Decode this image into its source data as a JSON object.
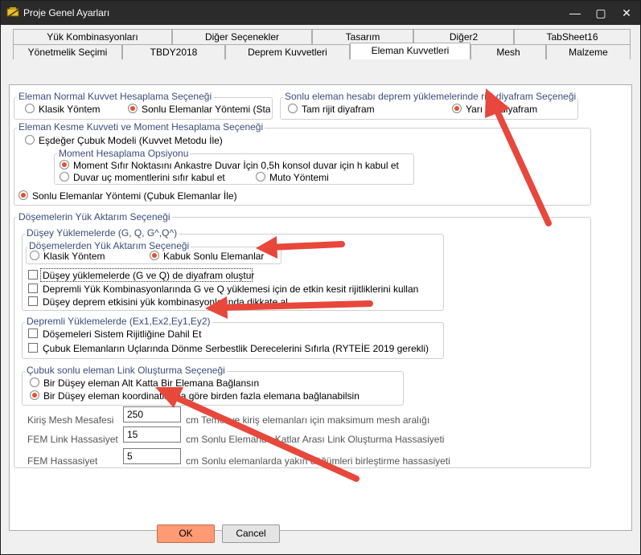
{
  "window": {
    "title": "Proje Genel Ayarları"
  },
  "tabs_row1": [
    "Yük Kombinasyonları",
    "Diğer Seçenekler",
    "Tasarım",
    "Diğer2",
    "TabSheet16"
  ],
  "tabs_row2": [
    "Yönetmelik Seçimi",
    "TBDY2018",
    "Deprem Kuvvetleri",
    "Eleman Kuvvetleri",
    "Mesh",
    "Malzeme"
  ],
  "active_tab": "Eleman Kuvvetleri",
  "normal_force": {
    "title": "Eleman Normal Kuvvet Hesaplama Seçeneği",
    "opt1": "Klasik Yöntem",
    "opt2": "Sonlu Elemanlar Yöntemi (Stat"
  },
  "diaphragm": {
    "title": "Sonlu eleman hesabı deprem yüklemelerinde rijit diyafram Seçeneği",
    "opt1": "Tam rijit diyafram",
    "opt2": "Yarı rijit diyafram"
  },
  "shear_moment": {
    "title": "Eleman Kesme Kuvveti ve Moment Hesaplama Seçeneği",
    "opt1": "Eşdeğer Çubuk Modeli (Kuvvet Metodu İle)",
    "moment_title": "Moment Hesaplama Opsiyonu",
    "m_opt1": "Moment Sıfır Noktasını Ankastre Duvar İçin 0,5h konsol duvar için h kabul et",
    "m_opt2": "Duvar uç momentlerini sıfır kabul et",
    "m_opt3": "Muto Yöntemi",
    "opt2": "Sonlu Elemanlar Yöntemi (Çubuk Elemanlar İle)"
  },
  "slab": {
    "title": "Döşemelerin Yük Aktarım Seçeneği",
    "vertical_title": "Düşey Yüklemelerde (G, Q, G^,Q^)",
    "transfer_title": "Döşemelerden  Yük Aktarım Seçeneği",
    "t_opt1": "Klasik Yöntem",
    "t_opt2": "Kabuk Sonlu Elemanlar",
    "chk1": "Düşey yüklemelerde (G ve Q) de diyafram oluştur",
    "chk2": "Depremli Yük Kombinasyonlarında G ve Q yüklemesi için de etkin kesit rijitliklerini kullan",
    "chk3": "Düşey deprem etkisini yük kombinasyonlarında dikkate al",
    "seismic_title": "Depremli Yüklemelerde (Ex1,Ex2,Ey1,Ey2)",
    "chk4": "Döşemeleri Sistem Rijitliğine Dahil Et",
    "chk5": "Çubuk Elemanların Uçlarında  Dönme Serbestlik Derecelerini Sıfırla (RYTEİE 2019 gerekli)",
    "link_title": "Çubuk sonlu eleman Link Oluşturma Seçeneği",
    "l_opt1": "Bir Düşey eleman Alt Katta Bir Elemana Bağlansın",
    "l_opt2": "Bir Düşey eleman koordinatlarına göre birden fazla elemana bağlanabilsin"
  },
  "fields": {
    "mesh_label": "Kiriş Mesh Mesafesi",
    "mesh_value": "250",
    "mesh_desc": "cm Temel ve kiriş elemanları için maksimum mesh aralığı",
    "link_label": "FEM Link Hassasiyet",
    "link_value": "15",
    "link_desc": "cm Sonlu Elemanda Katlar Arası Link Oluşturma Hassasiyeti",
    "fem_label": "FEM Hassasiyet",
    "fem_value": "5",
    "fem_desc": "cm Sonlu elemanlarda yakın düğümleri birleştirme hassasiyeti"
  },
  "buttons": {
    "ok": "OK",
    "cancel": "Cancel"
  },
  "colors": {
    "accent": "#e8502a",
    "arrow": "#e8473c",
    "ok_button": "#ff9a75",
    "group_title": "#3a4d7a"
  }
}
